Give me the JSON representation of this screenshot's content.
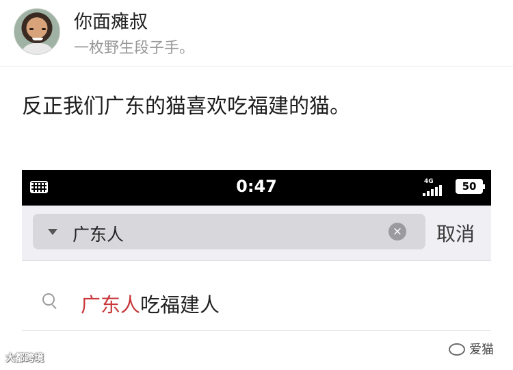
{
  "profile": {
    "name": "你面瘫叔",
    "subtitle": "一枚野生段子手。"
  },
  "post": {
    "text": "反正我们广东的猫喜欢吃福建的猫。"
  },
  "phone": {
    "status_bar": {
      "time": "0:47",
      "network": "4G",
      "battery": "50"
    },
    "search": {
      "value": "广东人",
      "cancel_label": "取消",
      "clear_symbol": "×"
    },
    "suggestion": {
      "highlight": "广东人",
      "rest": "吃福建人"
    }
  },
  "watermarks": {
    "left": "大都跨境",
    "right": "爱猫"
  },
  "icons": [
    "keyboard-icon",
    "signal-icon",
    "battery-icon",
    "dropdown-icon",
    "clear-icon",
    "search-icon",
    "wechat-icon"
  ],
  "colors": {
    "highlight": "#c8373a",
    "status_bar": "#000000",
    "search_bg": "#efeff4"
  }
}
